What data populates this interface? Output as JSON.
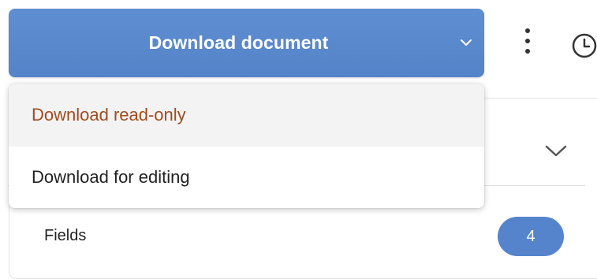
{
  "toolbar": {
    "download_button_label": "Download document",
    "download_chevron_icon": "chevron-down-icon",
    "more_icon": "kebab-vertical-icon",
    "history_icon": "clock-icon"
  },
  "download_menu": {
    "items": [
      {
        "label": "Download read-only",
        "state": "hover",
        "color": "#a34b1d"
      },
      {
        "label": "Download for editing"
      }
    ]
  },
  "panel": {
    "collapse_icon": "chevron-down-icon",
    "fields": {
      "label": "Fields",
      "count": "4"
    }
  },
  "colors": {
    "accent": "#5584cc",
    "hover_text": "#a34b1d"
  }
}
